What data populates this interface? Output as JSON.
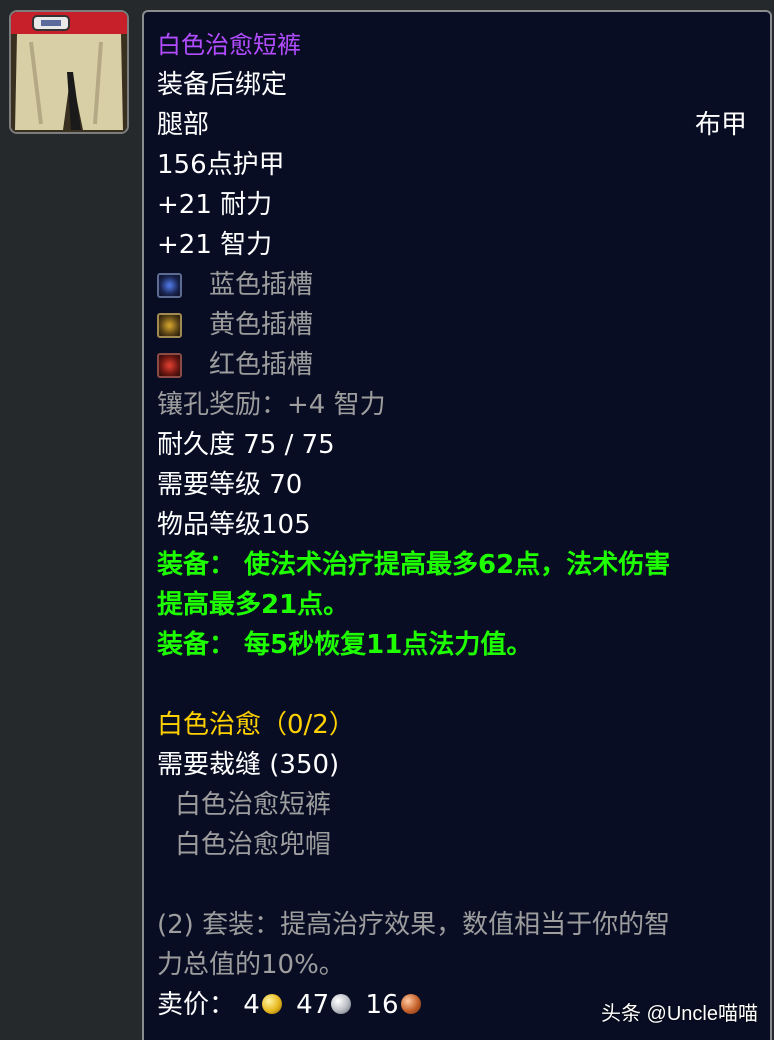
{
  "item": {
    "icon": "cloth-pants-icon",
    "name": "白色治愈短裤",
    "bind": "装备后绑定",
    "slot": "腿部",
    "armor_type": "布甲",
    "armor": "156点护甲",
    "stats": [
      "+21 耐力",
      "+21 智力"
    ],
    "sockets": [
      {
        "icon": "blue-socket-icon",
        "label": "蓝色插槽"
      },
      {
        "icon": "yellow-socket-icon",
        "label": "黄色插槽"
      },
      {
        "icon": "red-socket-icon",
        "label": "红色插槽"
      }
    ],
    "socket_bonus": "镶孔奖励：+4 智力",
    "durability": "耐久度 75 / 75",
    "required_level": "需要等级 70",
    "item_level": "物品等级105",
    "equip_effects": [
      "装备：  使法术治疗提高最多62点，法术伤害",
      "提高最多21点。",
      "装备：  每5秒恢复11点法力值。"
    ],
    "set_name": "白色治愈（0/2）",
    "set_requirement": "需要裁缝 (350)",
    "set_pieces": [
      "白色治愈短裤",
      "白色治愈兜帽"
    ],
    "set_bonus_lines": [
      "(2) 套装：提高治疗效果，数值相当于你的智",
      "力总值的10%。"
    ],
    "sell_price": {
      "label": "卖价：",
      "gold": "4",
      "silver": "47",
      "copper": "16"
    }
  },
  "watermark": "头条 @Uncle喵喵",
  "colors": {
    "epic_name": "#b24dff",
    "equip_green": "#1eff00",
    "set_gold": "#ffd100",
    "gray": "#9d9d9d",
    "tooltip_bg": "#080d24"
  }
}
